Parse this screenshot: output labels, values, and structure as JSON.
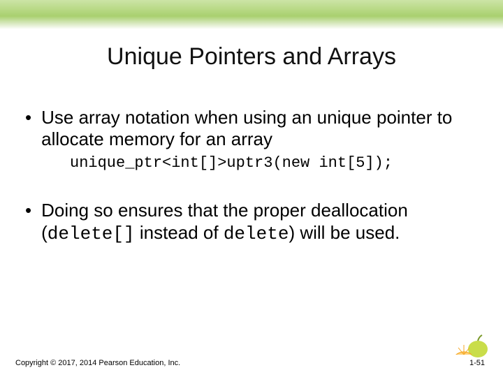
{
  "title": "Unique Pointers and Arrays",
  "bullets": [
    {
      "text": "Use array notation when using an unique pointer to allocate memory for an array",
      "code": "unique_ptr<int[]>uptr3(new int[5]);"
    },
    {
      "text_pre": "Doing so ensures that the proper deallocation (",
      "code1": "delete[]",
      "text_mid": " instead of ",
      "code2": "delete",
      "text_post": ") will be used."
    }
  ],
  "copyright": "Copyright © 2017, 2014 Pearson Education, Inc.",
  "pagenum": "1-51"
}
